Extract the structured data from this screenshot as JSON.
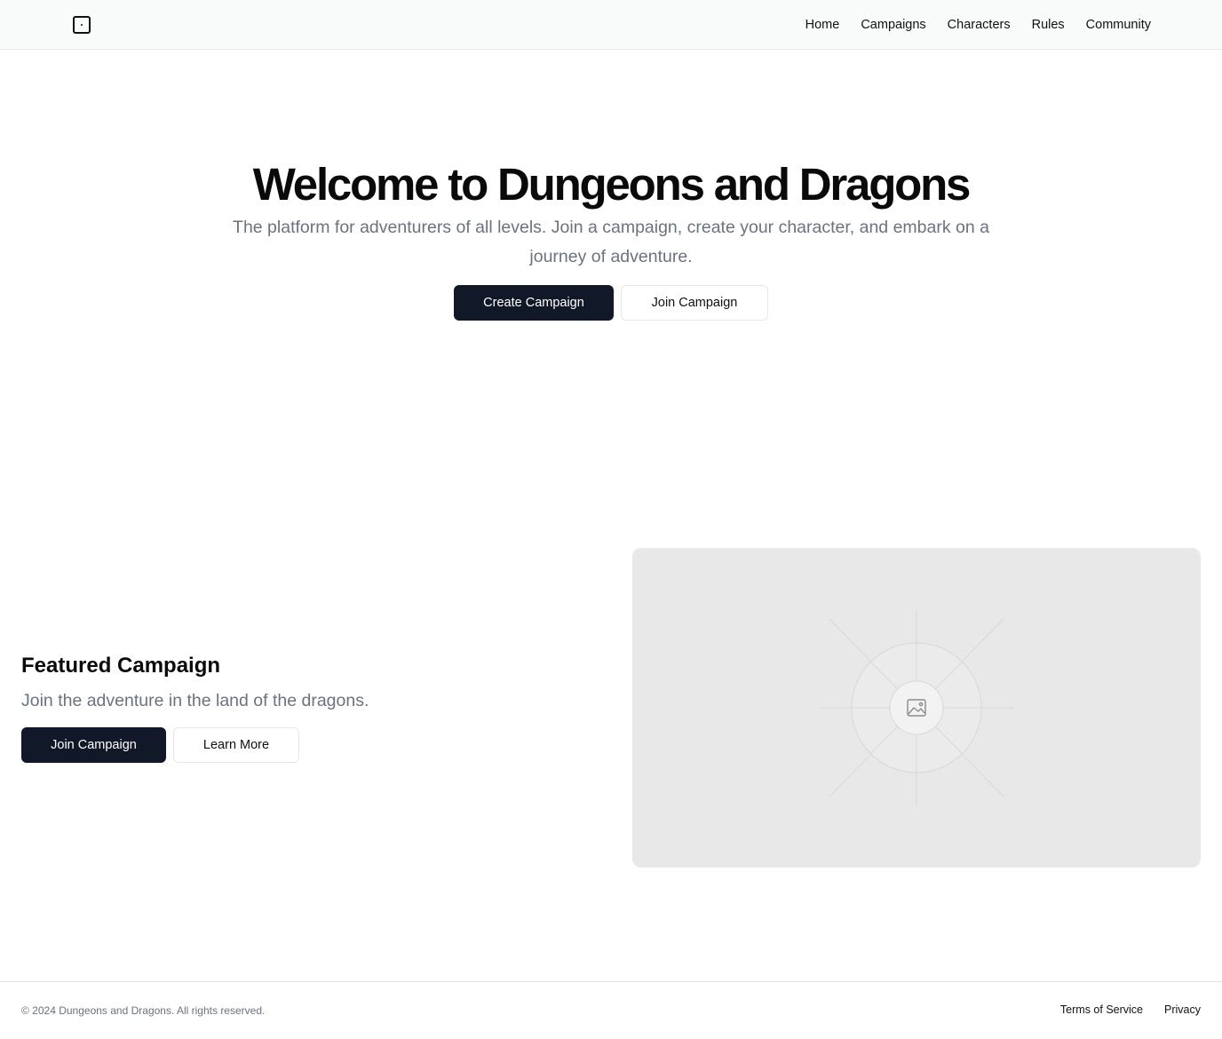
{
  "header": {
    "logo_icon": "square-dot-icon",
    "nav": [
      {
        "label": "Home"
      },
      {
        "label": "Campaigns"
      },
      {
        "label": "Characters"
      },
      {
        "label": "Rules"
      },
      {
        "label": "Community"
      }
    ]
  },
  "hero": {
    "title": "Welcome to Dungeons and Dragons",
    "subtitle": "The platform for adventurers of all levels. Join a campaign, create your character, and embark on a journey of adventure.",
    "primary_button": "Create Campaign",
    "secondary_button": "Join Campaign"
  },
  "featured": {
    "title": "Featured Campaign",
    "subtitle": "Join the adventure in the land of the dragons.",
    "primary_button": "Join Campaign",
    "secondary_button": "Learn More",
    "image_icon": "image-placeholder-icon"
  },
  "footer": {
    "copyright": "© 2024 Dungeons and Dragons. All rights reserved.",
    "links": [
      {
        "label": "Terms of Service"
      },
      {
        "label": "Privacy"
      }
    ]
  },
  "colors": {
    "primary_button_bg": "#111827",
    "muted_text": "#6b7280",
    "border": "#e5e7eb",
    "placeholder_bg": "#e8e8e8"
  }
}
